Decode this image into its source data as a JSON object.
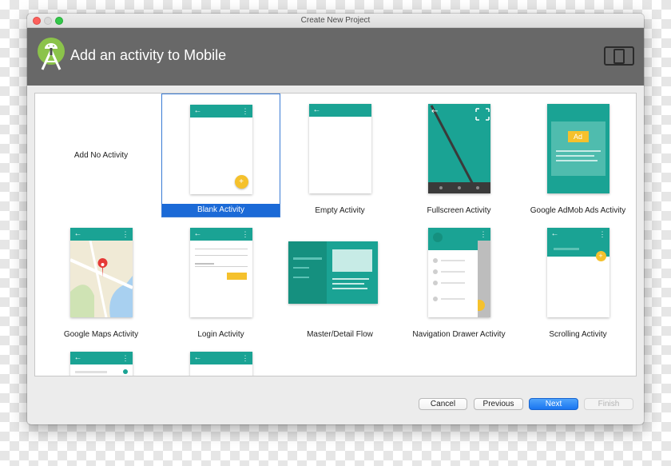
{
  "window": {
    "title": "Create New Project"
  },
  "header": {
    "title": "Add an activity to Mobile",
    "logo_icon": "android-studio-icon",
    "device_icon": "device-frame-icon"
  },
  "colors": {
    "accent": "#1aa394",
    "fab": "#f5c12c",
    "header_bg": "#686868",
    "selection": "#1b6ad7",
    "next_button": "#1a75f0"
  },
  "activities": [
    {
      "label": "Add No Activity",
      "selected": false
    },
    {
      "label": "Blank Activity",
      "selected": true
    },
    {
      "label": "Empty Activity",
      "selected": false
    },
    {
      "label": "Fullscreen Activity",
      "selected": false
    },
    {
      "label": "Google AdMob Ads Activity",
      "selected": false,
      "ad_badge": "Ad"
    },
    {
      "label": "Google Maps Activity",
      "selected": false
    },
    {
      "label": "Login Activity",
      "selected": false
    },
    {
      "label": "Master/Detail Flow",
      "selected": false
    },
    {
      "label": "Navigation Drawer Activity",
      "selected": false
    },
    {
      "label": "Scrolling Activity",
      "selected": false
    }
  ],
  "glyphs": {
    "back": "←",
    "overflow": "⋮",
    "fab_plus": "+"
  },
  "buttons": {
    "cancel": "Cancel",
    "previous": "Previous",
    "next": "Next",
    "finish": "Finish"
  }
}
